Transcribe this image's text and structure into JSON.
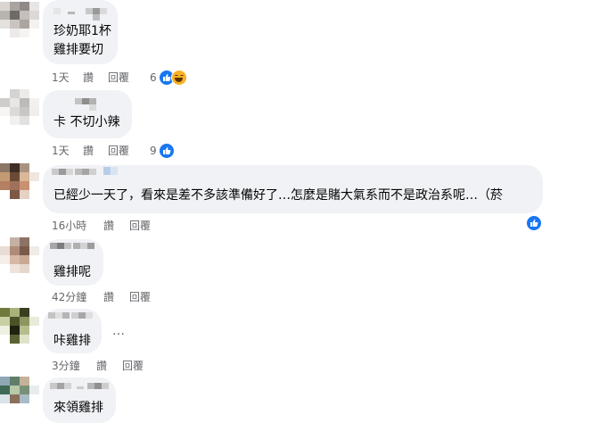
{
  "comments": [
    {
      "text": "珍奶耶1杯\n雞排要切",
      "meta": {
        "time": "1天",
        "like": "讚",
        "reply": "回覆"
      },
      "reactions": {
        "count": "6",
        "types": [
          "like-icon",
          "haha-icon"
        ]
      }
    },
    {
      "text": "卡 不切小辣",
      "meta": {
        "time": "1天",
        "like": "讚",
        "reply": "回覆"
      },
      "reactions": {
        "count": "9",
        "types": [
          "like-icon"
        ]
      }
    },
    {
      "text": "已經少一天了，看來是差不多該準備好了…怎麼是賭大氣系而不是政治系呢…（菸",
      "meta": {
        "time": "16小時",
        "like": "讚",
        "reply": "回覆"
      },
      "reactions": {
        "count": "",
        "types": [
          "like-icon"
        ]
      }
    },
    {
      "text": "雞排呢",
      "meta": {
        "time": "42分鐘",
        "like": "讚",
        "reply": "回覆"
      }
    },
    {
      "text": "咔雞排",
      "meta": {
        "time": "3分鐘",
        "like": "讚",
        "reply": "回覆"
      },
      "more": "…"
    },
    {
      "text": "來領雞排"
    }
  ],
  "colors": {
    "bubble": "#f0f2f5",
    "meta_text": "#65676b",
    "like_blue": "#1877f2",
    "haha_yellow": "#f7b125"
  }
}
